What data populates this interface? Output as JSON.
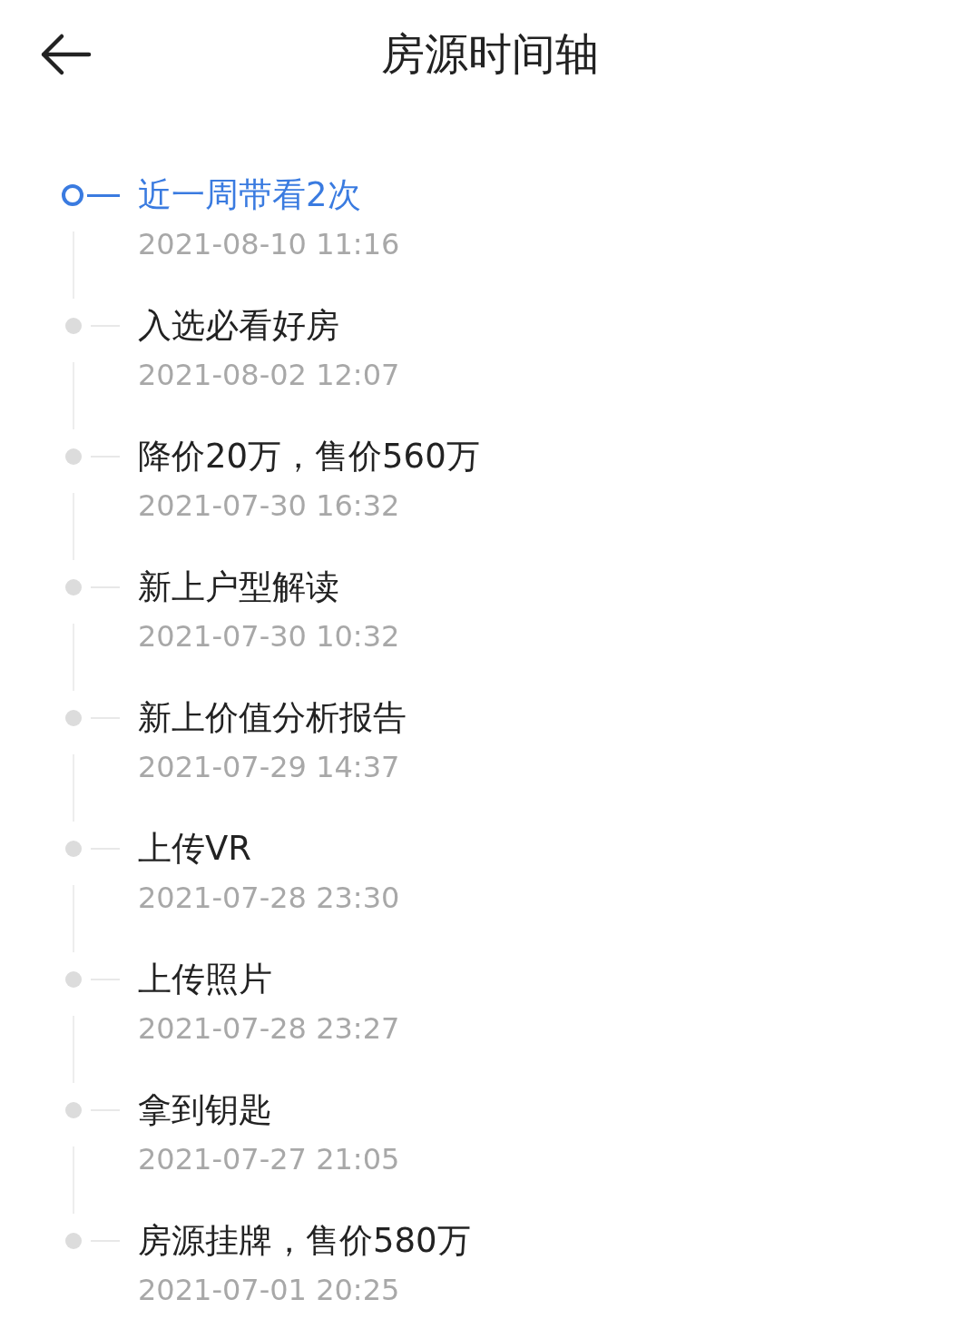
{
  "header": {
    "title": "房源时间轴"
  },
  "timeline": [
    {
      "title": "近一周带看2次",
      "time": "2021-08-10 11:16",
      "current": true
    },
    {
      "title": "入选必看好房",
      "time": "2021-08-02 12:07",
      "current": false
    },
    {
      "title": "降价20万，售价560万",
      "time": "2021-07-30 16:32",
      "current": false
    },
    {
      "title": "新上户型解读",
      "time": "2021-07-30 10:32",
      "current": false
    },
    {
      "title": "新上价值分析报告",
      "time": "2021-07-29 14:37",
      "current": false
    },
    {
      "title": "上传VR",
      "time": "2021-07-28 23:30",
      "current": false
    },
    {
      "title": "上传照片",
      "time": "2021-07-28 23:27",
      "current": false
    },
    {
      "title": "拿到钥匙",
      "time": "2021-07-27 21:05",
      "current": false
    },
    {
      "title": "房源挂牌，售价580万",
      "time": "2021-07-01 20:25",
      "current": false
    }
  ]
}
